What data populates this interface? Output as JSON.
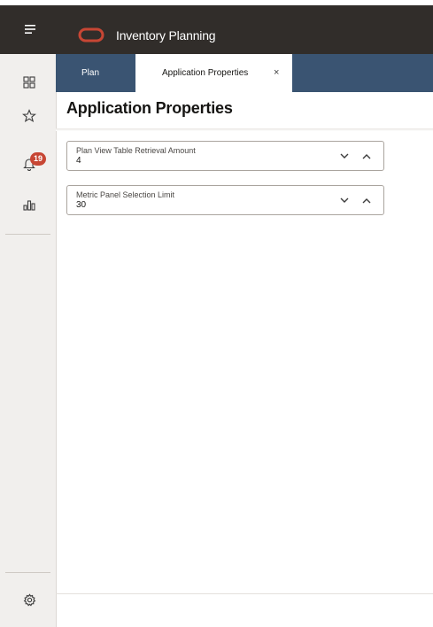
{
  "header": {
    "menu_icon": "hamburger-icon",
    "logo_icon": "oracle-logo-icon",
    "app_title": "Inventory Planning",
    "logo_color": "#c74634"
  },
  "rail": {
    "items": [
      {
        "icon": "grid-icon"
      },
      {
        "icon": "star-icon"
      },
      {
        "icon": "bell-icon",
        "badge": "19"
      },
      {
        "icon": "bar-chart-icon"
      }
    ],
    "settings_icon": "gear-icon"
  },
  "tabs": [
    {
      "label": "Plan",
      "active": false
    },
    {
      "label": "Application Properties",
      "active": true,
      "close": "×"
    }
  ],
  "page": {
    "title": "Application Properties"
  },
  "fields": [
    {
      "label": "Plan View Table Retrieval Amount",
      "value": "4"
    },
    {
      "label": "Metric Panel Selection Limit",
      "value": "30"
    }
  ],
  "colors": {
    "header_bg": "#312d2a",
    "tabstrip_bg": "#3a5472",
    "badge_bg": "#c74634"
  }
}
